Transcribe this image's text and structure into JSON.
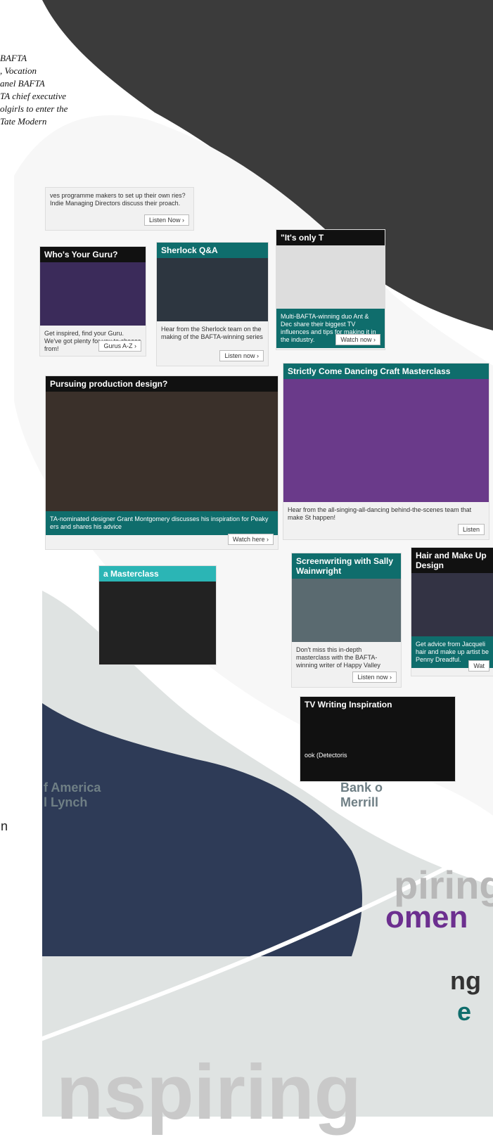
{
  "caption": {
    "lines": [
      "BAFTA",
      ", Vocation",
      "anel BAFTA",
      "TA chief executive",
      "olgirls to enter the",
      "Tate Modern"
    ]
  },
  "cards": [
    {
      "title": "",
      "text": "ves programme makers to set up their own ries? Indie Managing Directors discuss their proach.",
      "btn": "Listen Now ›",
      "theme": "teal"
    },
    {
      "title": "Who's Your Guru?",
      "text": "Get inspired, find your Guru. We've got plenty for you to choose from!",
      "btn": "Gurus A-Z ›",
      "theme": "dark"
    },
    {
      "title": "Sherlock Q&A",
      "text": "Hear from the Sherlock team on the making of the BAFTA-winning series",
      "btn": "Listen now ›",
      "theme": "teal"
    },
    {
      "title": "\"It's only T",
      "text": "Multi-BAFTA-winning duo Ant & Dec share their biggest TV influences and tips for making it in the industry.",
      "btn": "Watch now ›",
      "theme": "dark"
    },
    {
      "title": "Pursuing production design?",
      "text": "TA-nominated designer Grant Montgomery discusses his inspiration for Peaky ers and shares his advice",
      "btn": "Watch here ›",
      "theme": "dark"
    },
    {
      "title": "Strictly Come Dancing Craft Masterclass",
      "text": "Hear from the all-singing-all-dancing behind-the-scenes team that make St happen!",
      "btn": "Listen",
      "theme": "teal"
    },
    {
      "title": "a Masterclass",
      "text": "",
      "btn": "",
      "theme": "teal"
    },
    {
      "title": "Screenwriting with Sally Wainwright",
      "text": "Don't miss this in-depth masterclass with the BAFTA-winning writer of Happy Valley",
      "btn": "Listen now ›",
      "theme": "teal"
    },
    {
      "title": "Hair and Make Up Design",
      "text": "Get advice from Jacqueli hair and make up artist be Penny Dreadful.",
      "btn": "Wat",
      "theme": "dark"
    },
    {
      "title": "TV Writing Inspiration",
      "text": "ook (Detectoris",
      "btn": "",
      "theme": "dark"
    }
  ],
  "banners": {
    "bank_left": "f America\nl Lynch",
    "bank_right": "Bank o\nMerrill",
    "inspiring_top": "piring",
    "women": "omen",
    "ng": "ng",
    "e": "e",
    "inspiring_bottom": "nspiring",
    "letter_n": "n"
  },
  "colors": {
    "teal": "#0f6d6c",
    "dark": "#111111",
    "purple": "#6c2f8f"
  }
}
